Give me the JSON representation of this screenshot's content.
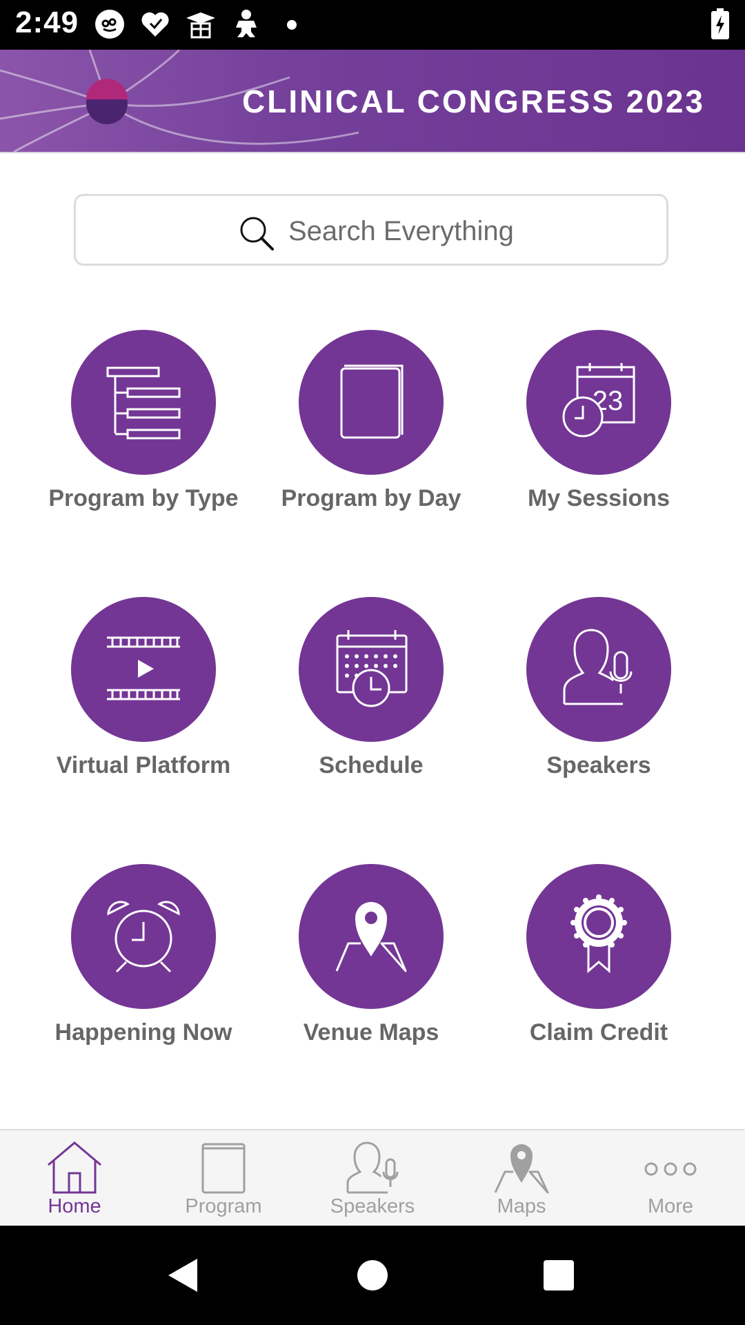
{
  "status_bar": {
    "time": "2:49",
    "icons": [
      "face-icon",
      "heart-icon",
      "graduation-icon",
      "baby-icon",
      "dot-icon"
    ],
    "battery": "battery-charging-icon"
  },
  "banner": {
    "title": "CLINICAL CONGRESS 2023"
  },
  "search": {
    "placeholder": "Search Everything"
  },
  "tiles": [
    {
      "label": "Program by Type",
      "icon": "hierarchy-list-icon"
    },
    {
      "label": "Program by Day",
      "icon": "book-icon"
    },
    {
      "label": "My Sessions",
      "icon": "calendar-clock-icon"
    },
    {
      "label": "Virtual Platform",
      "icon": "film-play-icon"
    },
    {
      "label": "Schedule",
      "icon": "calendar-grid-icon"
    },
    {
      "label": "Speakers",
      "icon": "speaker-mic-icon"
    },
    {
      "label": "Happening Now",
      "icon": "alarm-clock-icon"
    },
    {
      "label": "Venue Maps",
      "icon": "map-pin-icon"
    },
    {
      "label": "Claim Credit",
      "icon": "ribbon-award-icon"
    }
  ],
  "calendar_number": "23",
  "bottom_nav": [
    {
      "label": "Home",
      "icon": "home-icon",
      "active": true
    },
    {
      "label": "Program",
      "icon": "book-icon",
      "active": false
    },
    {
      "label": "Speakers",
      "icon": "speaker-mic-icon",
      "active": false
    },
    {
      "label": "Maps",
      "icon": "map-pin-icon",
      "active": false
    },
    {
      "label": "More",
      "icon": "more-dots-icon",
      "active": false
    }
  ],
  "colors": {
    "brand_purple": "#733695",
    "label_gray": "#666666",
    "nav_inactive": "#a0a0a0"
  }
}
